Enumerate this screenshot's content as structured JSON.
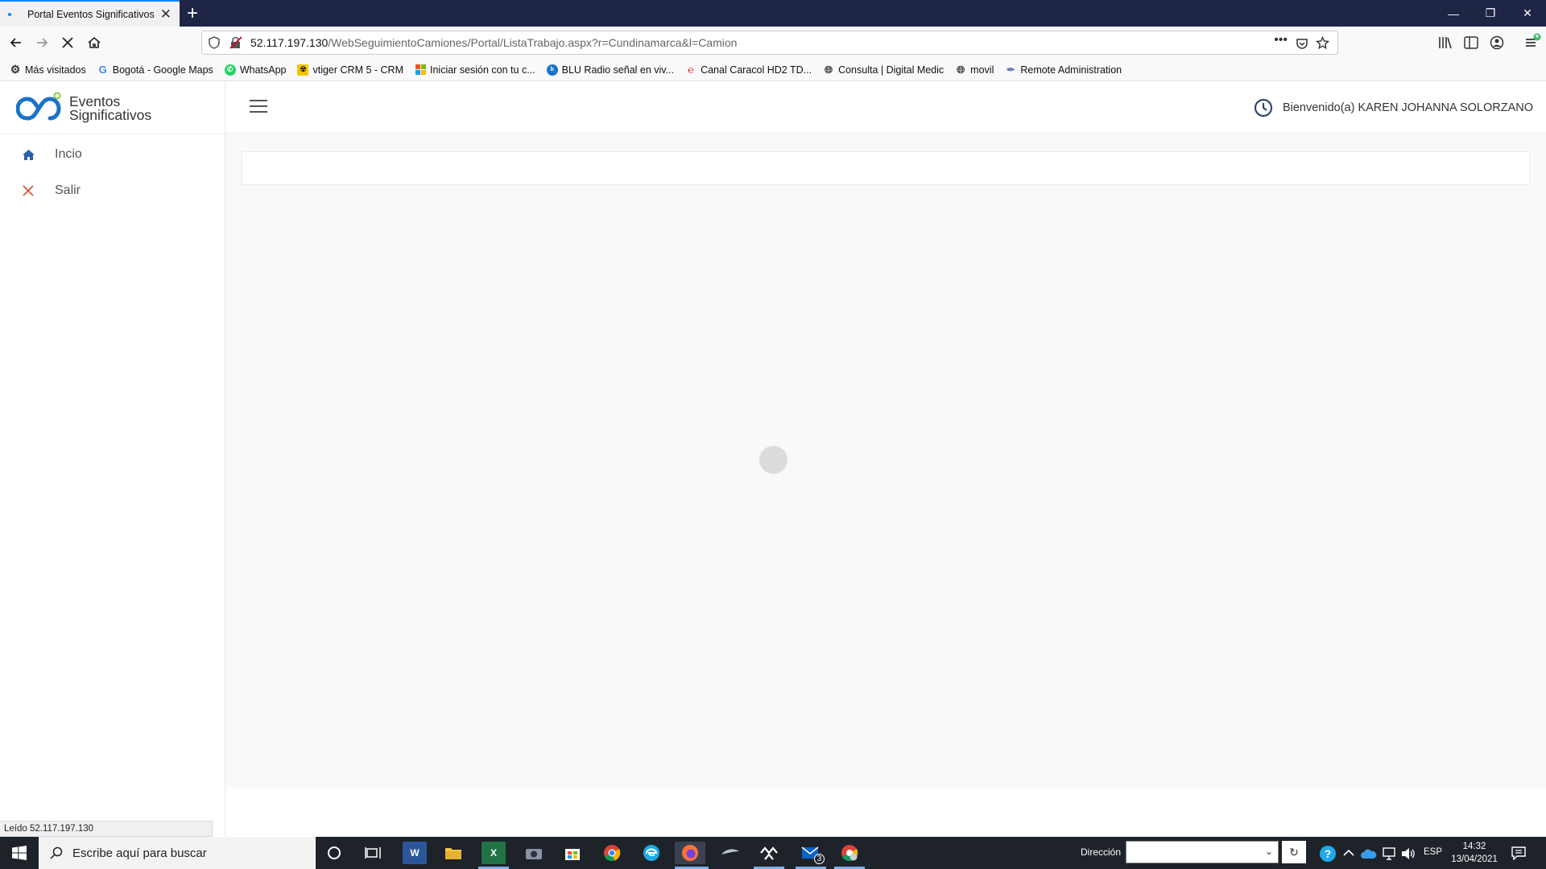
{
  "browser": {
    "tab_title": "Portal Eventos Significativos",
    "url_host": "52.117.197.130",
    "url_path": "/WebSeguimientoCamiones/Portal/ListaTrabajo.aspx?r=Cundinamarca&l=Camion",
    "status_text": "Leído 52.117.197.130"
  },
  "bookmarks": [
    {
      "label": "Más visitados",
      "icon": "gear-icon"
    },
    {
      "label": "Bogotá - Google Maps",
      "icon": "google-icon"
    },
    {
      "label": "WhatsApp",
      "icon": "whatsapp-icon"
    },
    {
      "label": "vtiger CRM 5 - CRM",
      "icon": "vtiger-icon"
    },
    {
      "label": "Iniciar sesión con tu c...",
      "icon": "microsoft-icon"
    },
    {
      "label": "BLU Radio señal en viv...",
      "icon": "blu-radio-icon"
    },
    {
      "label": "Canal Caracol HD2 TD...",
      "icon": "caracol-icon"
    },
    {
      "label": "Consulta | Digital Medic",
      "icon": "globe-icon"
    },
    {
      "label": "movil",
      "icon": "globe-icon"
    },
    {
      "label": "Remote Administration",
      "icon": "feather-icon"
    }
  ],
  "app": {
    "brand_line1": "Eventos",
    "brand_line2": "Significativos",
    "menu": [
      {
        "label": "Incio",
        "icon": "home-icon"
      },
      {
        "label": "Salir",
        "icon": "close-icon"
      }
    ],
    "welcome": "Bienvenido(a) KAREN JOHANNA SOLORZANO"
  },
  "taskbar": {
    "search_placeholder": "Escribe aquí para buscar",
    "direccion_label": "Dirección",
    "lang": "ESP",
    "time": "14:32",
    "date": "13/04/2021",
    "mail_badge": "3"
  },
  "colors": {
    "tabstrip": "#1f2545",
    "accent": "#0a84ff",
    "brand_blue": "#1a73c9",
    "brand_green": "#8cc63f",
    "salir_red": "#e0543c"
  }
}
